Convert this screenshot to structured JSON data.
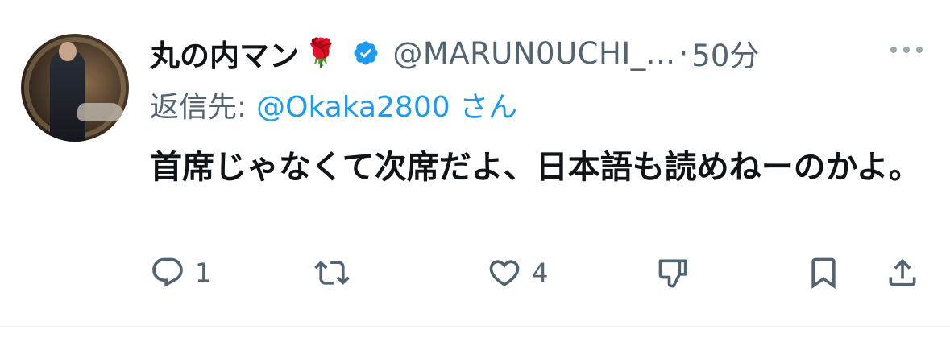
{
  "author": {
    "display_name": "丸の内マン",
    "emoji": "🌹",
    "handle": "@MARUN0UCHI_...",
    "separator": "·",
    "time": "50分"
  },
  "reply_to": {
    "label": "返信先:",
    "mention": "@Okaka2800 さん"
  },
  "tweet": {
    "text": "首席じゃなくて次席だよ、日本語も読めねーのかよ。"
  },
  "actions": {
    "reply_count": "1",
    "retweet_count": "",
    "like_count": "4"
  },
  "colors": {
    "accent": "#1d9bf0",
    "secondary_text": "#536471",
    "primary_text": "#0f1419"
  }
}
